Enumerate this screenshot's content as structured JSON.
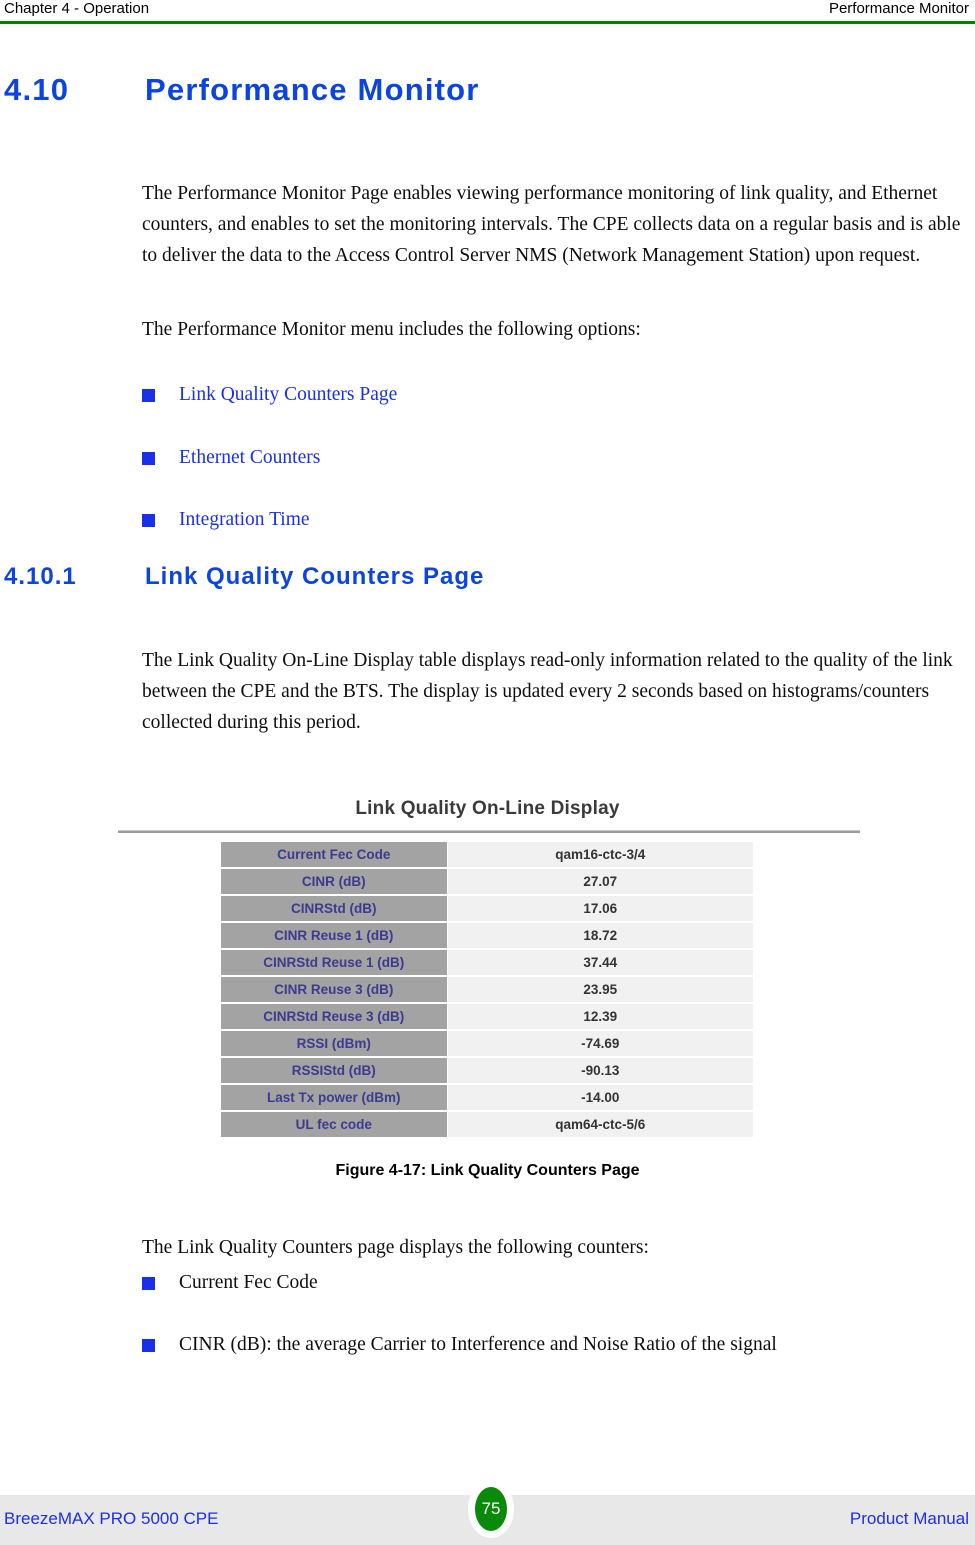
{
  "header": {
    "left": "Chapter 4 - Operation",
    "right": "Performance Monitor",
    "rule_color": "#008000"
  },
  "section": {
    "number": "4.10",
    "title": "Performance Monitor",
    "color": "#0b44e0"
  },
  "paragraphs": {
    "intro": "The Performance Monitor Page enables viewing performance monitoring of link quality, and Ethernet counters, and enables to set the monitoring intervals. The CPE collects data on a regular basis and is able to deliver the data to the Access Control Server NMS (Network Management Station) upon request.",
    "menu_intro": "The Performance Monitor menu includes the following options:",
    "link_quality": "The Link Quality On-Line Display table displays read-only information related to the quality of the link between the CPE and the BTS. The display is updated every 2 seconds based on histograms/counters collected during this period.",
    "counters_intro": "The Link Quality Counters page displays the following counters:"
  },
  "menu_options": [
    {
      "label": "Link Quality Counters Page"
    },
    {
      "label": "Ethernet Counters"
    },
    {
      "label": "Integration Time"
    }
  ],
  "subsection": {
    "number": "4.10.1",
    "title": "Link Quality Counters Page",
    "color": "#0b44e0"
  },
  "figure": {
    "panel_title": "Link Quality On-Line Display",
    "caption": "Figure 4-17: Link Quality Counters Page",
    "label_bg": "#a3a3a3",
    "label_color": "#3b3b8f",
    "value_bg": "#f1f1f1",
    "rows": [
      {
        "label": "Current Fec Code",
        "value": "qam16-ctc-3/4"
      },
      {
        "label": "CINR (dB)",
        "value": "27.07"
      },
      {
        "label": "CINRStd (dB)",
        "value": "17.06"
      },
      {
        "label": "CINR Reuse 1 (dB)",
        "value": "18.72"
      },
      {
        "label": "CINRStd Reuse 1 (dB)",
        "value": "37.44"
      },
      {
        "label": "CINR Reuse 3 (dB)",
        "value": "23.95"
      },
      {
        "label": "CINRStd Reuse 3 (dB)",
        "value": "12.39"
      },
      {
        "label": "RSSI (dBm)",
        "value": "-74.69"
      },
      {
        "label": "RSSIStd (dB)",
        "value": "-90.13"
      },
      {
        "label": "Last Tx power (dBm)",
        "value": "-14.00"
      },
      {
        "label": "UL fec code",
        "value": "qam64-ctc-5/6"
      }
    ]
  },
  "counter_bullets": [
    {
      "label": "Current Fec Code"
    },
    {
      "label": "CINR (dB): the average Carrier to Interference and Noise Ratio of the signal"
    }
  ],
  "footer": {
    "left": "BreezeMAX PRO 5000 CPE",
    "page_number": "75",
    "right": "Product Manual",
    "badge_color": "#0a8a0a",
    "band_color": "#e8e8e8"
  }
}
